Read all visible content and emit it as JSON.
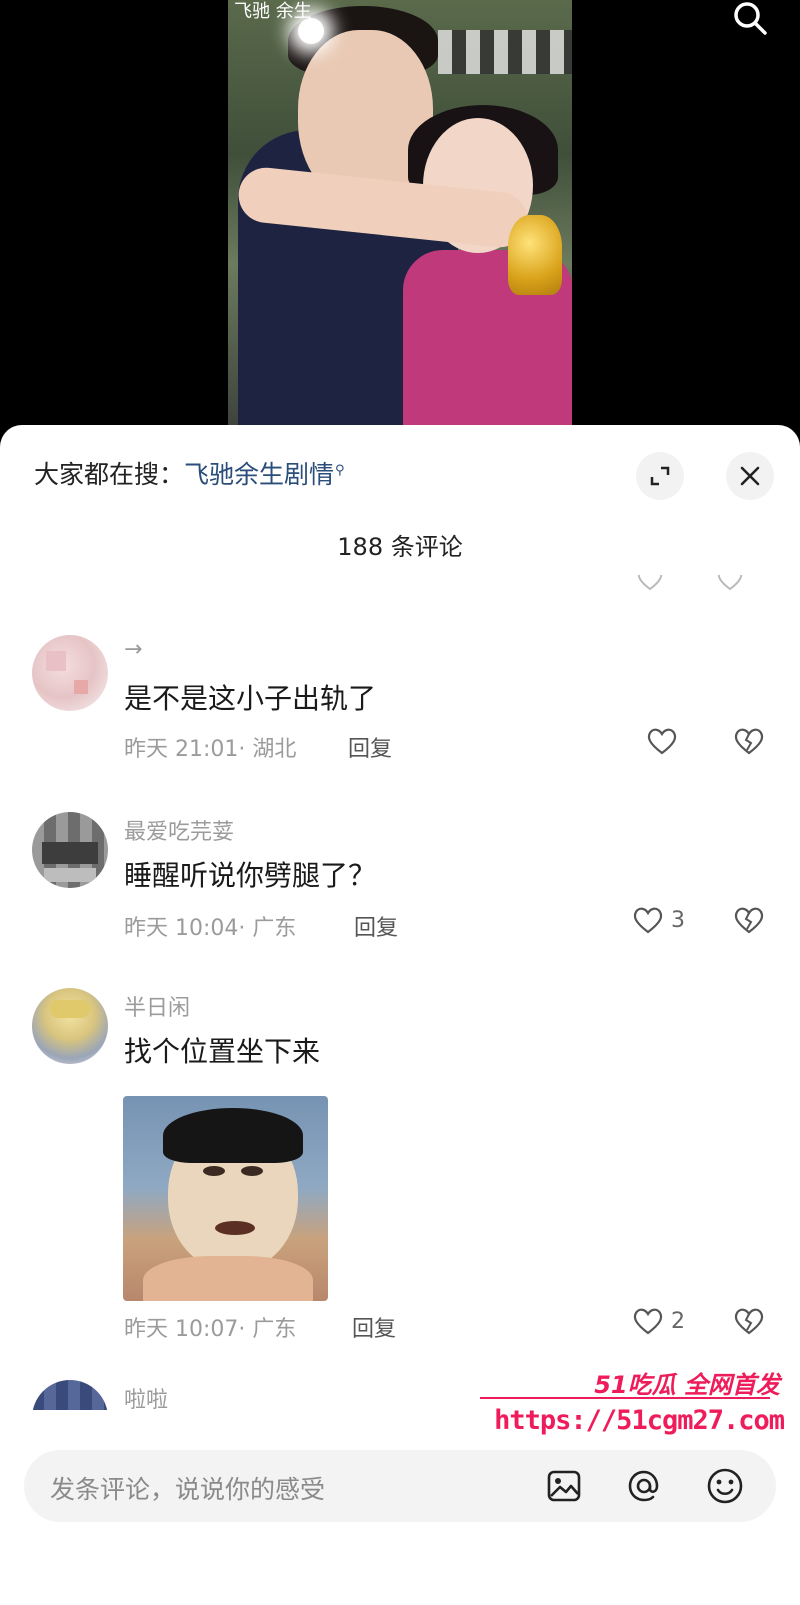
{
  "video": {
    "poster_title": "飞驰 余生"
  },
  "sheet": {
    "hot_prefix": "大家都在搜：",
    "hot_term": "飞驰余生剧情",
    "comment_count": "188 条评论"
  },
  "comments": [
    {
      "username": "→",
      "text": "是不是这小子出轨了",
      "time": "昨天 21:01",
      "location": "· 湖北",
      "reply_label": "回复",
      "likes": ""
    },
    {
      "username": "最爱吃芫荽",
      "text": "睡醒听说你劈腿了？",
      "time": "昨天 10:04",
      "location": "· 广东",
      "reply_label": "回复",
      "likes": "3"
    },
    {
      "username": "半日闲",
      "text": "找个位置坐下来",
      "time": "昨天 10:07",
      "location": "· 广东",
      "reply_label": "回复",
      "likes": "2"
    },
    {
      "username": "啦啦",
      "text": ""
    }
  ],
  "input": {
    "placeholder": "发条评论，说说你的感受"
  },
  "watermark": {
    "brand": "51吃瓜 全网首发",
    "url": "https://51cgm27.com"
  },
  "icons": {
    "search": "search-icon",
    "expand": "expand-icon",
    "close": "close-icon",
    "like": "heart-icon",
    "dislike": "broken-heart-icon",
    "image": "image-icon",
    "mention": "at-icon",
    "emoji": "emoji-icon"
  },
  "colors": {
    "link": "#2a4d7a",
    "watermark": "#ee1c5a"
  }
}
